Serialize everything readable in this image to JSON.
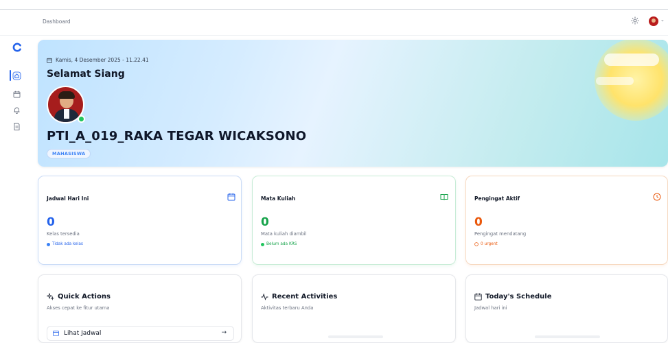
{
  "header": {
    "breadcrumb": "Dashboard",
    "theme_icon": "sun-icon",
    "user_avatar": "avatar"
  },
  "sidebar": {
    "logo_icon": "app-logo-icon",
    "items": [
      {
        "icon": "home-icon",
        "active": true
      },
      {
        "icon": "calendar-icon",
        "active": false
      },
      {
        "icon": "bell-icon",
        "active": false
      },
      {
        "icon": "document-icon",
        "active": false
      }
    ]
  },
  "hero": {
    "date": "Kamis, 4 Desember 2025 - 11.22.41",
    "greeting": "Selamat Siang",
    "name": "PTI_A_019_RAKA TEGAR WICAKSONO",
    "role": "MAHASISWA",
    "online": true
  },
  "stats": [
    {
      "title": "Jadwal Hari Ini",
      "value": "0",
      "subtitle": "Kelas tersedia",
      "note": "Tidak ada kelas",
      "color": "#2563eb",
      "icon": "calendar-icon"
    },
    {
      "title": "Mata Kuliah",
      "value": "0",
      "subtitle": "Mata kuliah diambil",
      "note": "Belum ada KRS",
      "color": "#16a34a",
      "icon": "book-icon"
    },
    {
      "title": "Pengingat Aktif",
      "value": "0",
      "subtitle": "Pengingat mendatang",
      "note": "0 urgent",
      "color": "#ea580c",
      "icon": "clock-icon"
    }
  ],
  "panels": {
    "quick_actions": {
      "title": "Quick Actions",
      "subtitle": "Akses cepat ke fitur utama",
      "first_item": "Lihat Jadwal",
      "arrow": "→"
    },
    "recent_activities": {
      "title": "Recent Activities",
      "subtitle": "Aktivitas terbaru Anda"
    },
    "todays_schedule": {
      "title": "Today's Schedule",
      "subtitle": "Jadwal hari ini"
    }
  },
  "colors": {
    "primary": "#2563eb",
    "success": "#16a34a",
    "warning": "#ea580c"
  }
}
